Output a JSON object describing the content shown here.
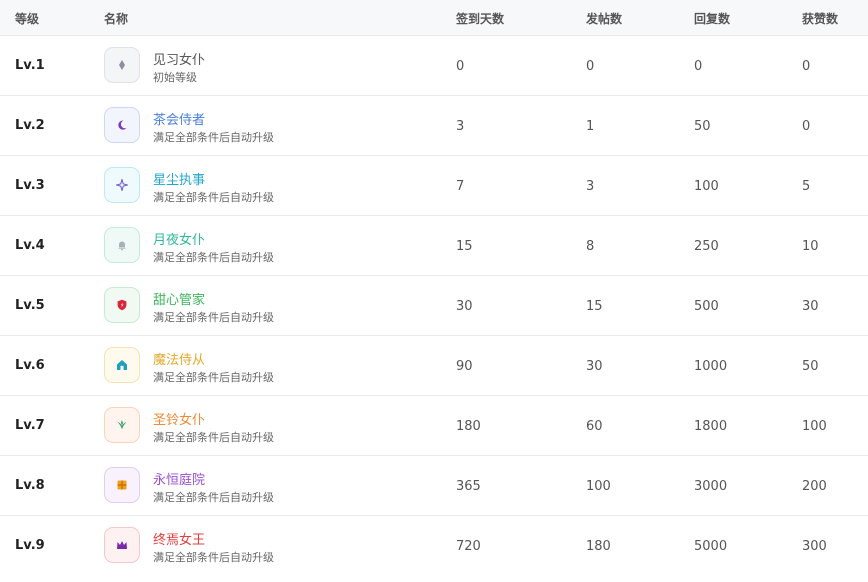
{
  "headers": {
    "level": "等级",
    "name": "名称",
    "checkin": "签到天数",
    "posts": "发帖数",
    "replies": "回复数",
    "likes": "获赞数"
  },
  "levels": [
    {
      "lv": "Lv.1",
      "name": "见习女仆",
      "desc": "初始等级",
      "checkin": "0",
      "posts": "0",
      "replies": "0",
      "likes": "0",
      "color": "#555555",
      "icon": "diamond-icon",
      "icon_color": "#8a90a0",
      "badge_bg": "#f4f5f7",
      "badge_border": "#dfe2e8"
    },
    {
      "lv": "Lv.2",
      "name": "茶会侍者",
      "desc": "满足全部条件后自动升级",
      "checkin": "3",
      "posts": "1",
      "replies": "50",
      "likes": "0",
      "color": "#4a7fd6",
      "icon": "crescent-moon-icon",
      "icon_color": "#7a3bb8",
      "badge_bg": "#f3f5fd",
      "badge_border": "#cfd8f3"
    },
    {
      "lv": "Lv.3",
      "name": "星尘执事",
      "desc": "满足全部条件后自动升级",
      "checkin": "7",
      "posts": "3",
      "replies": "100",
      "likes": "5",
      "color": "#23a7c9",
      "icon": "sparkle-icon",
      "icon_color": "#6e58c8",
      "badge_bg": "#effafd",
      "badge_border": "#bfe8f3"
    },
    {
      "lv": "Lv.4",
      "name": "月夜女仆",
      "desc": "满足全部条件后自动升级",
      "checkin": "15",
      "posts": "8",
      "replies": "250",
      "likes": "10",
      "color": "#2fb89a",
      "icon": "bell-icon",
      "icon_color": "#a8b0b8",
      "badge_bg": "#effaf6",
      "badge_border": "#c4eadf"
    },
    {
      "lv": "Lv.5",
      "name": "甜心管家",
      "desc": "满足全部条件后自动升级",
      "checkin": "30",
      "posts": "15",
      "replies": "500",
      "likes": "30",
      "color": "#3cb65a",
      "icon": "shield-icon",
      "icon_color": "#d8263a",
      "badge_bg": "#f0faf2",
      "badge_border": "#c7ebcf"
    },
    {
      "lv": "Lv.6",
      "name": "魔法侍从",
      "desc": "满足全部条件后自动升级",
      "checkin": "90",
      "posts": "30",
      "replies": "1000",
      "likes": "50",
      "color": "#e3a92a",
      "icon": "house-icon",
      "icon_color": "#1ea0b8",
      "badge_bg": "#fffaee",
      "badge_border": "#f5e2b5"
    },
    {
      "lv": "Lv.7",
      "name": "圣铃女仆",
      "desc": "满足全部条件后自动升级",
      "checkin": "180",
      "posts": "60",
      "replies": "1800",
      "likes": "100",
      "color": "#ef8a3a",
      "icon": "leaf-icon",
      "icon_color": "#2f9a72",
      "badge_bg": "#fff5ee",
      "badge_border": "#f6d5bd"
    },
    {
      "lv": "Lv.8",
      "name": "永恒庭院",
      "desc": "满足全部条件后自动升级",
      "checkin": "365",
      "posts": "100",
      "replies": "3000",
      "likes": "200",
      "color": "#9a4fcf",
      "icon": "gift-box-icon",
      "icon_color": "#f0a020",
      "badge_bg": "#f9f2fd",
      "badge_border": "#e2cdf1"
    },
    {
      "lv": "Lv.9",
      "name": "终焉女王",
      "desc": "满足全部条件后自动升级",
      "checkin": "720",
      "posts": "180",
      "replies": "5000",
      "likes": "300",
      "color": "#e23c3c",
      "icon": "crown-icon",
      "icon_color": "#7a2aa8",
      "badge_bg": "#fdf1f1",
      "badge_border": "#f3c9c9"
    }
  ]
}
